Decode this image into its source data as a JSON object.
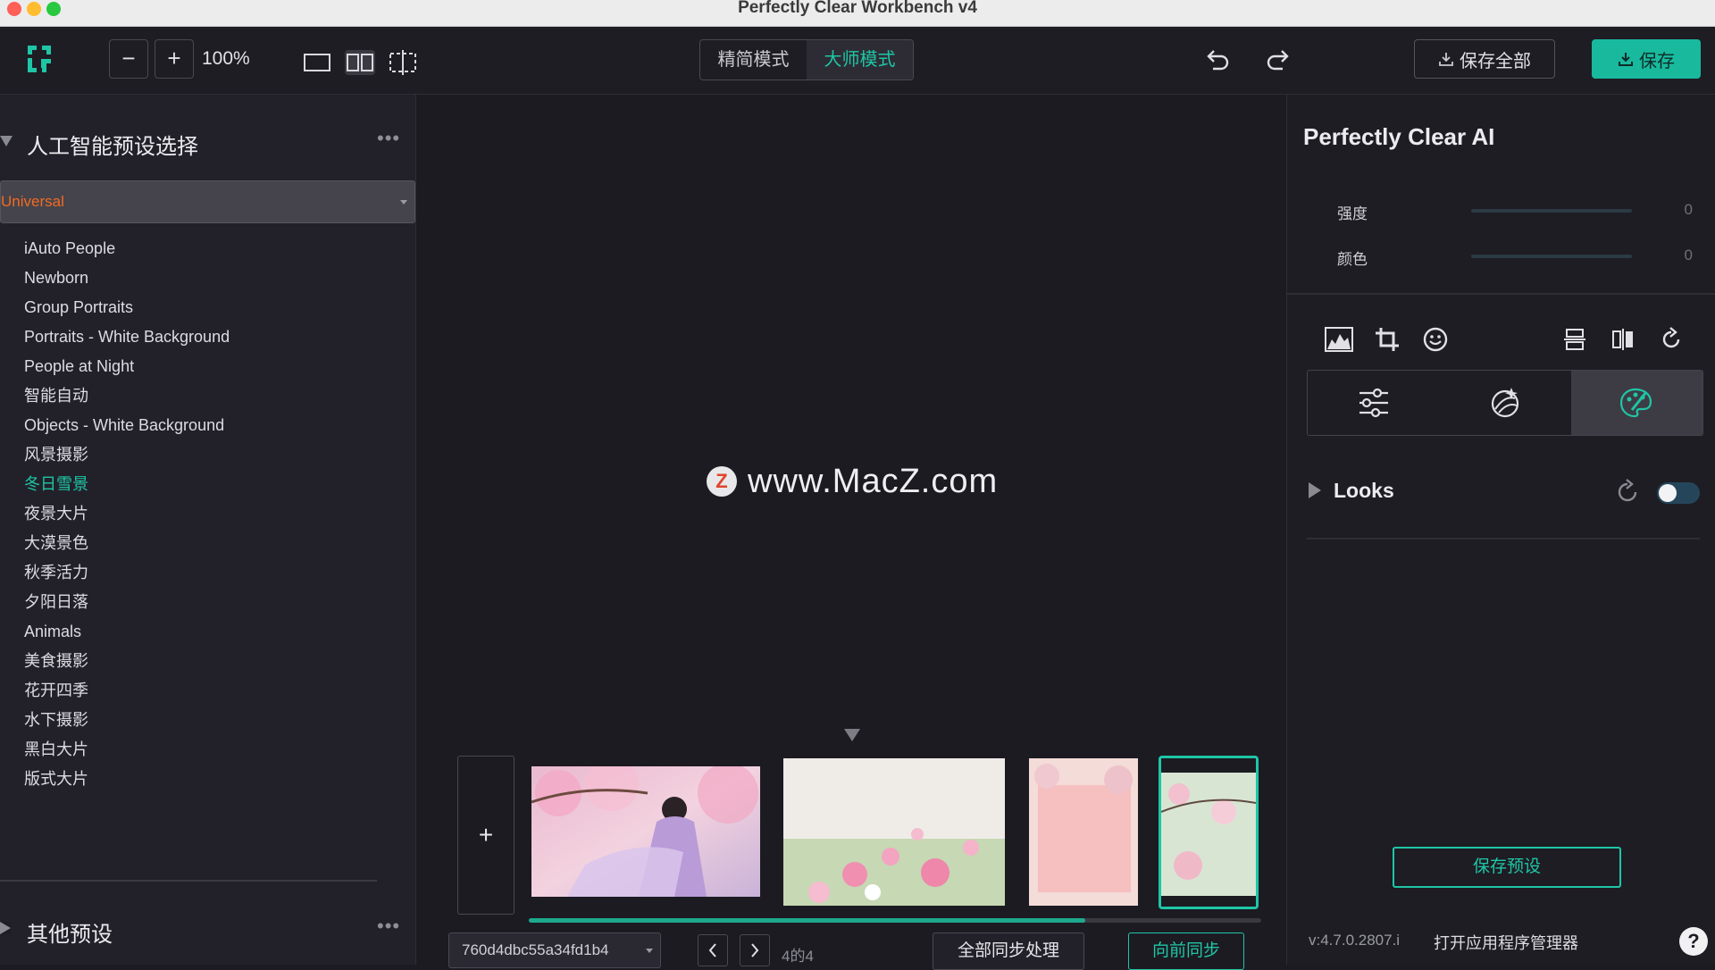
{
  "window": {
    "title": "Perfectly Clear Workbench v4"
  },
  "toolbar": {
    "zoom_out": "−",
    "zoom_in": "+",
    "zoom_level": "100%",
    "modes": [
      {
        "label": "精简模式",
        "active": false
      },
      {
        "label": "大师模式",
        "active": true
      }
    ],
    "save_all_label": "保存全部",
    "save_label": "保存",
    "accent_color": "#1ec6a6"
  },
  "left_panel": {
    "ai_section_title": "人工智能预设选择",
    "more": "•••",
    "preset_selected": "Universal",
    "presets": [
      "iAuto People",
      "Newborn",
      "Group Portraits",
      "Portraits - White Background",
      "People at Night",
      "智能自动",
      "Objects - White Background",
      "风景摄影",
      "冬日雪景",
      "夜景大片",
      "大漠景色",
      "秋季活力",
      "夕阳日落",
      "Animals",
      "美食摄影",
      "花开四季",
      "水下摄影",
      "黑白大片",
      "版式大片"
    ],
    "highlighted_preset": "冬日雪景",
    "other_section_title": "其他预设"
  },
  "canvas": {
    "watermark_badge": "Z",
    "watermark_text": "www.MacZ.com",
    "add_label": "+",
    "filmstrip_progress": 0.76,
    "file_name": "760d4dbc55a34fd1b4",
    "page_indicator": "4的4",
    "sync_all_label": "全部同步处理",
    "sync_forward_label": "向前同步"
  },
  "right_panel": {
    "title": "Perfectly Clear AI",
    "sliders": [
      {
        "label": "强度",
        "value": "0"
      },
      {
        "label": "颜色",
        "value": "0"
      }
    ],
    "looks_label": "Looks",
    "looks_enabled": false,
    "save_preset_label": "保存预设",
    "version": "v:4.7.0.2807.i",
    "app_manager_label": "打开应用程序管理器",
    "help_label": "?"
  }
}
